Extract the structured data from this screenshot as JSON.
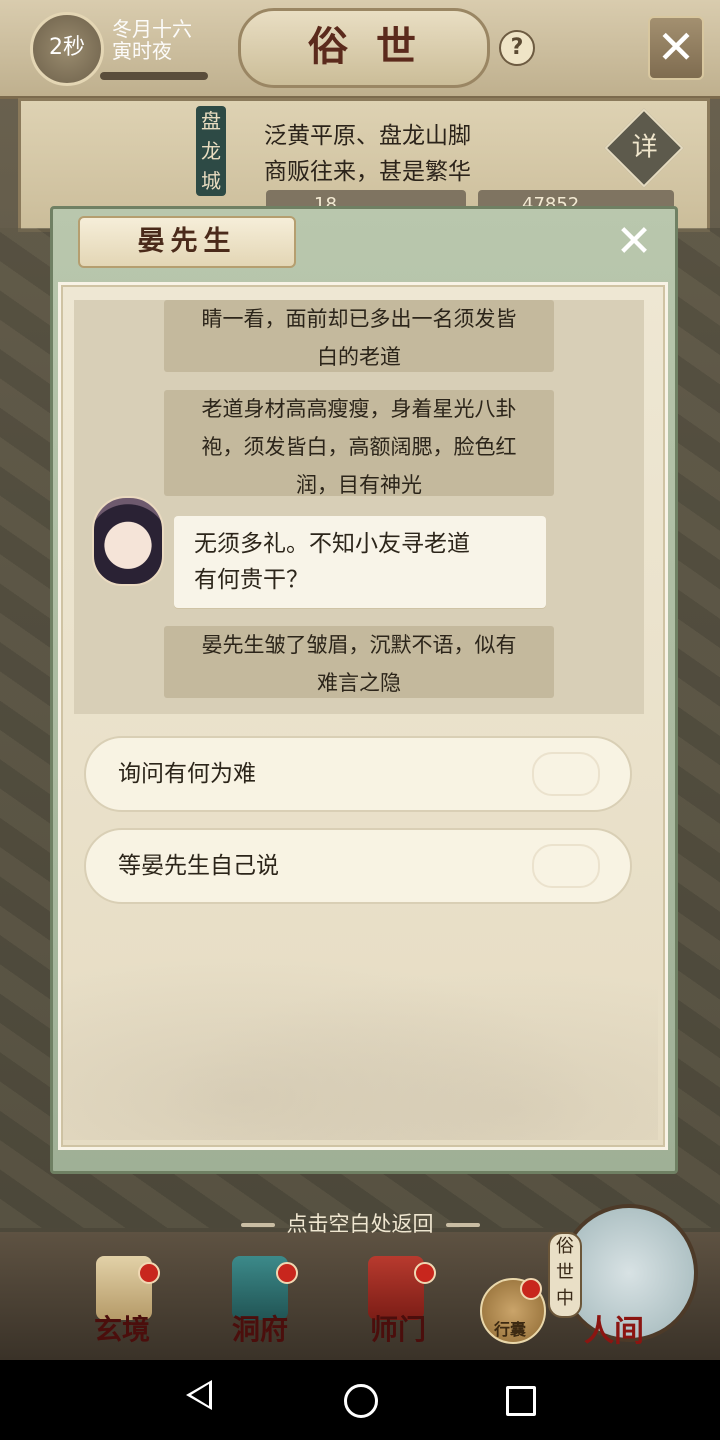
{
  "header": {
    "timer": "2秒",
    "date_line1": "冬月十六",
    "date_line2": "寅时夜",
    "title": "俗世",
    "help_icon": "?",
    "close_icon": "✕"
  },
  "location": {
    "city_tag": "盘龙城",
    "line1": "泛黄平原、盘龙山脚",
    "line2": "商贩往来，甚是繁华",
    "detail_label": "详",
    "stat1": "18",
    "stat2": "47852"
  },
  "dialog": {
    "title": "晏先生",
    "close_icon": "✕",
    "narration": [
      "睛一看，面前却已多出一名须发皆白的老道",
      "老道身材高高瘦瘦，身着星光八卦袍，须发皆白，高额阔腮，脸色红润，目有神光",
      "晏先生皱了皱眉，沉默不语，似有难言之隐"
    ],
    "narration_lines": {
      "n1a": "睛一看，面前却已多出一名须发皆",
      "n1b": "白的老道",
      "n2a": "老道身材高高瘦瘦，身着星光八卦",
      "n2b": "袍，须发皆白，高额阔腮，脸色红",
      "n2c": "润，目有神光",
      "n3a": "晏先生皱了皱眉，沉默不语，似有",
      "n3b": "难言之隐"
    },
    "speech_line1": "无须多礼。不知小友寻老道",
    "speech_line2": "有何贵干？",
    "choices": [
      "询问有何为难",
      "等晏先生自己说"
    ]
  },
  "hint": "点击空白处返回",
  "bottom_nav": {
    "items": [
      "玄境",
      "洞府",
      "师门",
      "行囊"
    ],
    "world_tag": "俗世中",
    "world_label": "人间"
  },
  "colors": {
    "accent_red": "#c8261d",
    "panel_green": "#9fb096",
    "parchment": "#eee7d3"
  }
}
